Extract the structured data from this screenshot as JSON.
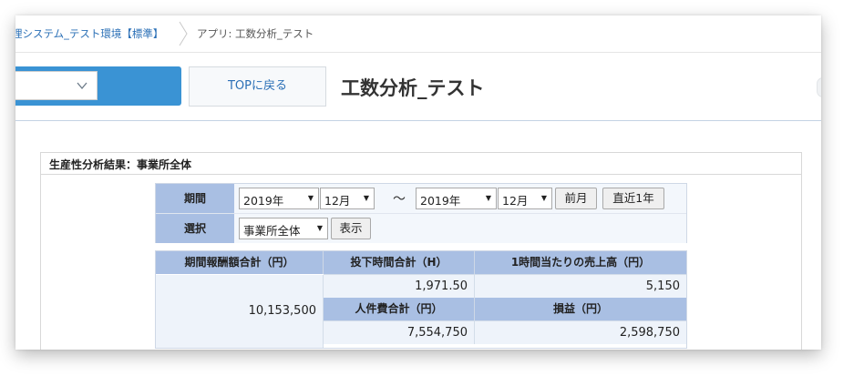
{
  "breadcrumb": {
    "parent": "理システム_テスト環境【標準】",
    "current": "アプリ: 工数分析_テスト"
  },
  "header": {
    "top_button": "TOPに戻る",
    "title": "工数分析_テスト"
  },
  "panel": {
    "title": "生産性分析結果：事業所全体"
  },
  "filters": {
    "period_label": "期間",
    "from_year": "2019年",
    "from_month": "12月",
    "separator": "〜",
    "to_year": "2019年",
    "to_month": "12月",
    "prev_month_button": "前月",
    "recent_year_button": "直近1年",
    "select_label": "選択",
    "scope_value": "事業所全体",
    "show_button": "表示"
  },
  "results": {
    "headers": {
      "total_compensation": "期間報酬額合計（円）",
      "total_hours": "投下時間合計（H）",
      "sales_per_hour": "1時間当たりの売上高（円）",
      "labor_cost": "人件費合計（円）",
      "profit": "損益（円）"
    },
    "values": {
      "total_compensation": "10,153,500",
      "total_hours": "1,971.50",
      "sales_per_hour": "5,150",
      "labor_cost": "7,554,750",
      "profit": "2,598,750"
    }
  },
  "colors": {
    "accent_blue": "#3a93d4",
    "header_cell": "#a9bfe3",
    "link": "#2a6fb6"
  }
}
